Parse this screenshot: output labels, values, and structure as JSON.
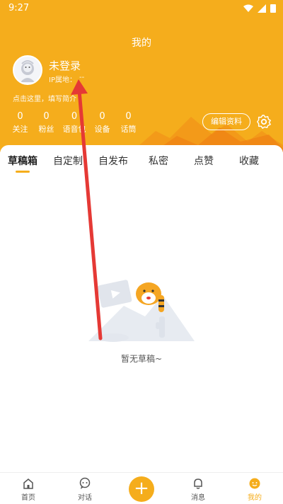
{
  "status_bar": {
    "time": "9:27"
  },
  "profile": {
    "page_title": "我的",
    "username": "未登录",
    "ip_label": "IP属地：",
    "ip_value": "--",
    "bio_prompt": "点击这里，填写简介",
    "edit_label": "编辑资料"
  },
  "stats": [
    {
      "value": "0",
      "label": "关注"
    },
    {
      "value": "0",
      "label": "粉丝"
    },
    {
      "value": "0",
      "label": "语音包"
    },
    {
      "value": "0",
      "label": "设备"
    },
    {
      "value": "0",
      "label": "话筒"
    }
  ],
  "tabs": [
    {
      "label": "草稿箱",
      "active": true
    },
    {
      "label": "自定制",
      "active": false
    },
    {
      "label": "自发布",
      "active": false
    },
    {
      "label": "私密",
      "active": false
    },
    {
      "label": "点赞",
      "active": false
    },
    {
      "label": "收藏",
      "active": false
    }
  ],
  "empty_state": {
    "text": "暂无草稿~"
  },
  "bottom_nav": [
    {
      "label": "首页",
      "icon": "home-icon",
      "active": false
    },
    {
      "label": "对话",
      "icon": "chat-icon",
      "active": false
    },
    {
      "label": "",
      "icon": "plus-icon",
      "active": false
    },
    {
      "label": "消息",
      "icon": "bell-icon",
      "active": false
    },
    {
      "label": "我的",
      "icon": "profile-icon",
      "active": true
    }
  ],
  "colors": {
    "accent": "#f5ad1c",
    "arrow": "#e53935"
  }
}
